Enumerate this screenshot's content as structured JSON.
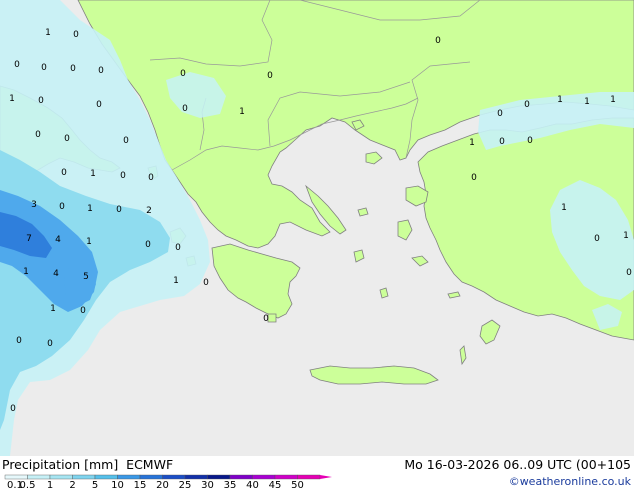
{
  "map": {
    "title": "Precipitation [mm]",
    "model": "ECMWF",
    "datetime": "Mo 16-03-2026 06..09 UTC (00+105",
    "credit": "©weatheronline.co.uk",
    "colors": {
      "sea": "#ececec",
      "land": "#ccff99",
      "coast": "#808080",
      "border": "#999999",
      "precip_light": "#c6f2f6",
      "precip_mid": "#8fdcef",
      "precip_heavy": "#4fa9ec",
      "precip_heavier": "#2f7fdc"
    },
    "legend": {
      "labels": [
        "0.1",
        "0.5",
        "1",
        "2",
        "5",
        "10",
        "15",
        "20",
        "25",
        "30",
        "35",
        "40",
        "45",
        "50"
      ],
      "colors": [
        "#e6f8fb",
        "#c6f0f6",
        "#a6e5f2",
        "#7fd4ee",
        "#55c0ea",
        "#3a98e6",
        "#2773d8",
        "#1b4ec6",
        "#1230a8",
        "#08188a",
        "#7f00c8",
        "#a800d2",
        "#cf00c8",
        "#e500b4"
      ]
    },
    "values": [
      "1",
      "0",
      "0",
      "0",
      "0",
      "0",
      "1",
      "0",
      "0",
      "0",
      "0",
      "0",
      "0",
      "0",
      "0",
      "0",
      "1",
      "0",
      "1",
      "0",
      "0",
      "1",
      "1",
      "1",
      "0",
      "0",
      "3",
      "0",
      "1",
      "0",
      "2",
      "7",
      "4",
      "1",
      "0",
      "0",
      "1",
      "4",
      "5",
      "1",
      "0",
      "1",
      "0",
      "0",
      "0",
      "0",
      "1",
      "0",
      "0",
      "1",
      "0",
      "0",
      "1",
      "0",
      "0"
    ]
  }
}
